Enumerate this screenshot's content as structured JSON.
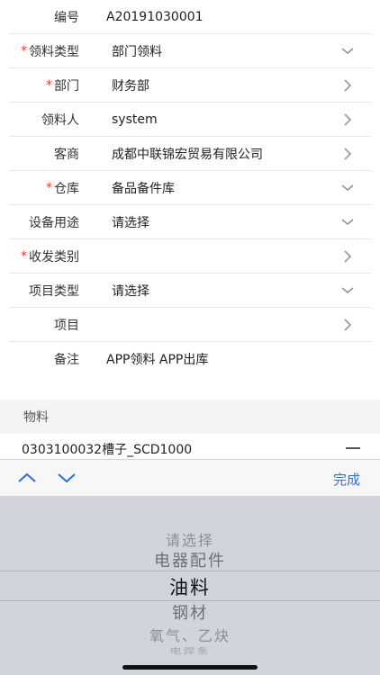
{
  "form": {
    "rows": [
      {
        "label": "编号",
        "required": false,
        "value": "A20191030001",
        "icon": "none"
      },
      {
        "label": "领料类型",
        "required": true,
        "value": "部门领料",
        "icon": "chevron-down-icon"
      },
      {
        "label": "部门",
        "required": true,
        "value": "财务部",
        "icon": "chevron-right-icon"
      },
      {
        "label": "领料人",
        "required": false,
        "value": "system",
        "icon": "chevron-right-icon"
      },
      {
        "label": "客商",
        "required": false,
        "value": "成都中联锦宏贸易有限公司",
        "icon": "chevron-right-icon"
      },
      {
        "label": "仓库",
        "required": true,
        "value": "备品备件库",
        "icon": "chevron-down-icon"
      },
      {
        "label": "设备用途",
        "required": false,
        "value": "请选择",
        "icon": "chevron-down-icon"
      },
      {
        "label": "收发类别",
        "required": true,
        "value": "",
        "icon": "chevron-right-icon"
      },
      {
        "label": "项目类型",
        "required": false,
        "value": "请选择",
        "icon": "chevron-down-icon"
      },
      {
        "label": "项目",
        "required": false,
        "value": "",
        "icon": "chevron-right-icon"
      },
      {
        "label": "备注",
        "required": false,
        "value": "APP领料 APP出库",
        "icon": "none"
      }
    ],
    "required_mark": "*"
  },
  "materials": {
    "section_title": "物料",
    "item": "0303100032槽子_SCD1000"
  },
  "toolbar": {
    "done_label": "完成"
  },
  "picker": {
    "options": [
      "请选择",
      "电器配件",
      "油料",
      "钢材",
      "氧气、乙炔",
      "电焊条"
    ],
    "selected": "油料"
  },
  "colors": {
    "accent": "#2e6fd6",
    "required": "#e0413a"
  }
}
